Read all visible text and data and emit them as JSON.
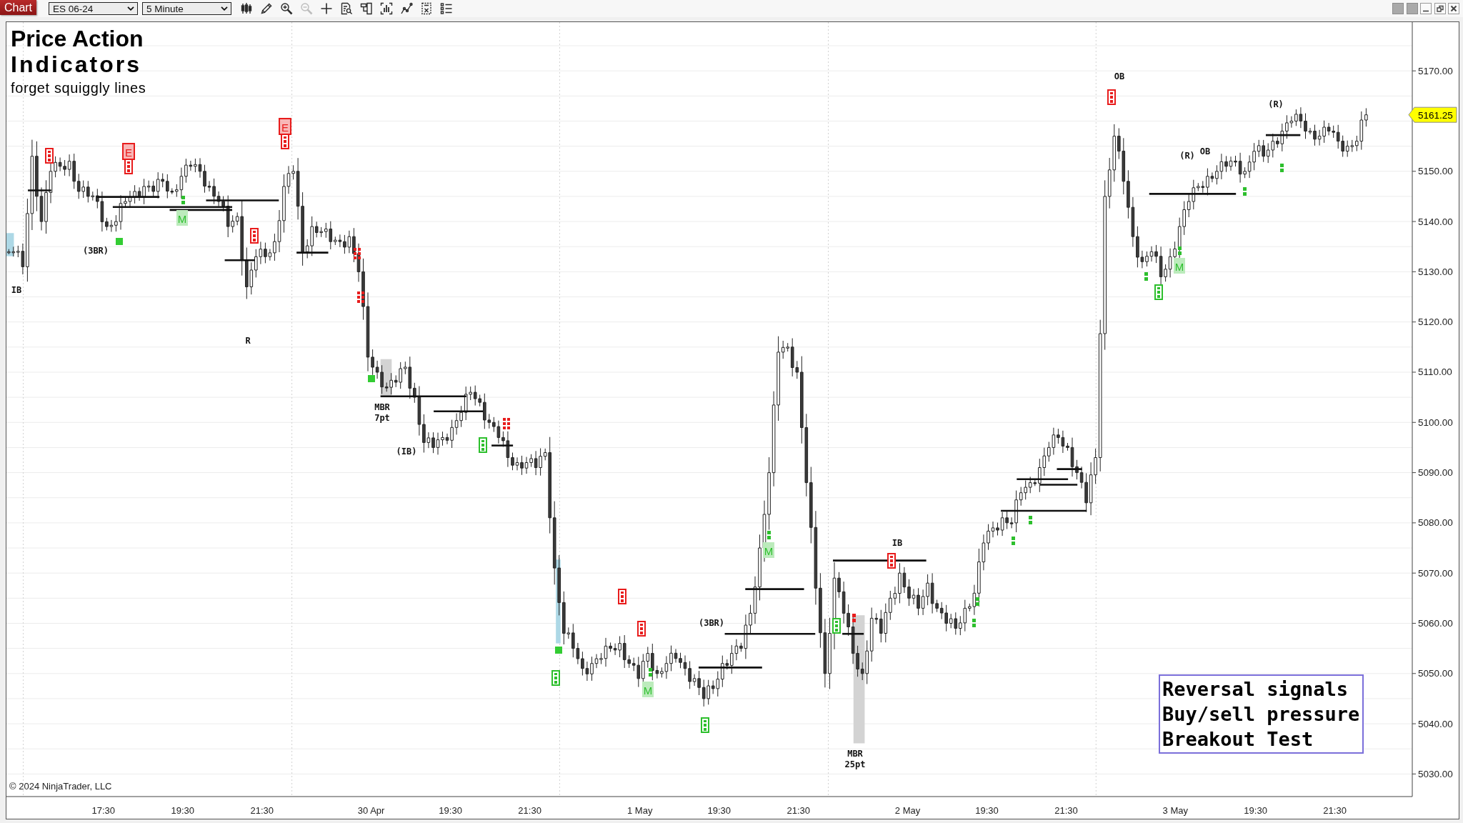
{
  "toolbar": {
    "tab": "Chart",
    "instrument": "ES 06-24",
    "interval": "5 Minute",
    "tools": [
      {
        "kind": "candles",
        "disabled": false
      },
      {
        "kind": "pencil",
        "disabled": false
      },
      {
        "kind": "zoom_in",
        "disabled": false
      },
      {
        "kind": "zoom_out",
        "disabled": true
      },
      {
        "kind": "crosshair",
        "disabled": false
      },
      {
        "kind": "document",
        "disabled": false
      },
      {
        "kind": "panel",
        "disabled": false
      },
      {
        "kind": "chart_box",
        "disabled": false
      },
      {
        "kind": "line",
        "disabled": false
      },
      {
        "kind": "strategy",
        "disabled": false
      },
      {
        "kind": "list",
        "disabled": false
      }
    ]
  },
  "window_controls": [
    {
      "kind": "tile"
    },
    {
      "kind": "tile"
    },
    {
      "kind": "minimize"
    },
    {
      "kind": "restore"
    },
    {
      "kind": "close"
    }
  ],
  "chart": {
    "title_lines": [
      "Price Action",
      "Indicators"
    ],
    "subtitle": "forget squiggly lines",
    "labels": [
      "IB",
      "(3BR)",
      "R",
      "MBR 7pt",
      "(IB)",
      "(3BR)",
      "MBR 25pt",
      "IB",
      "OB",
      "(R)",
      "OB",
      "(R)"
    ],
    "tags": [
      {
        "text": "E",
        "color": "#e81c1c",
        "outlined": true
      },
      {
        "text": "E",
        "color": "#e81c1c",
        "outlined": true
      },
      {
        "text": "M",
        "color": "#2dbf2d",
        "outlined": false
      },
      {
        "text": "M",
        "color": "#2dbf2d",
        "outlined": false
      },
      {
        "text": "M",
        "color": "#2dbf2d",
        "outlined": false
      },
      {
        "text": "M",
        "color": "#2dbf2d",
        "outlined": false
      }
    ],
    "markers": [
      {
        "kind": "box",
        "color": "#e81c1c"
      },
      {
        "kind": "box",
        "color": "#e81c1c"
      },
      {
        "kind": "box",
        "color": "#e81c1c"
      },
      {
        "kind": "box",
        "color": "#e81c1c"
      },
      {
        "kind": "dot_grid",
        "color": "#e81c1c"
      },
      {
        "kind": "dot_grid",
        "color": "#e81c1c"
      },
      {
        "kind": "dot_grid",
        "color": "#e81c1c"
      },
      {
        "kind": "box",
        "color": "#e81c1c"
      },
      {
        "kind": "box",
        "color": "#e81c1c"
      },
      {
        "kind": "box",
        "color": "#e81c1c"
      },
      {
        "kind": "box",
        "color": "#e81c1c"
      },
      {
        "kind": "box",
        "color": "#2dbf2d"
      },
      {
        "kind": "box",
        "color": "#2dbf2d"
      },
      {
        "kind": "box",
        "color": "#2dbf2d"
      },
      {
        "kind": "box",
        "color": "#2dbf2d"
      },
      {
        "kind": "box",
        "color": "#2dbf2d"
      },
      {
        "kind": "square",
        "color": "#33cc33"
      },
      {
        "kind": "square",
        "color": "#33cc33"
      },
      {
        "kind": "square",
        "color": "#33cc33"
      },
      {
        "kind": "dots",
        "color": "#2dbf2d"
      },
      {
        "kind": "dots",
        "color": "#2dbf2d"
      },
      {
        "kind": "dots",
        "color": "#2dbf2d"
      },
      {
        "kind": "dots",
        "color": "#2dbf2d"
      },
      {
        "kind": "dots",
        "color": "#2dbf2d"
      },
      {
        "kind": "dots",
        "color": "#2dbf2d"
      },
      {
        "kind": "dots",
        "color": "#2dbf2d"
      },
      {
        "kind": "dots",
        "color": "#2dbf2d"
      },
      {
        "kind": "dots",
        "color": "#2dbf2d"
      },
      {
        "kind": "dots",
        "color": "#2dbf2d"
      },
      {
        "kind": "dots",
        "color": "#2dbf2d"
      },
      {
        "kind": "dots",
        "color": "#e81c1c"
      }
    ],
    "price_labels": [
      "5170.00",
      "5150.00",
      "5140.00",
      "5130.00",
      "5120.00",
      "5110.00",
      "5100.00",
      "5090.00",
      "5080.00",
      "5070.00",
      "5060.00",
      "5050.00",
      "5040.00",
      "5030.00"
    ],
    "last_price": "5161.25",
    "time_labels": [
      "17:30",
      "19:30",
      "21:30",
      "30 Apr",
      "19:30",
      "21:30",
      "1 May",
      "19:30",
      "21:30",
      "2 May",
      "19:30",
      "21:30",
      "3 May",
      "19:30",
      "21:30"
    ],
    "legend_lines": [
      "Reversal signals",
      "Buy/sell pressure",
      "Breakout Test"
    ],
    "copyright": "© 2024 NinjaTrader, LLC"
  }
}
